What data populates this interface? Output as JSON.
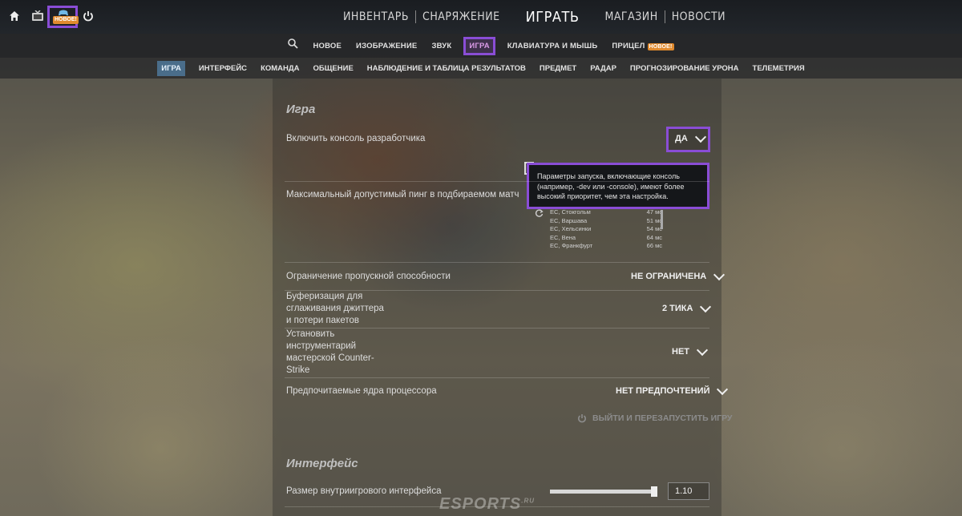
{
  "topbar": {
    "home_icon": "home-icon",
    "tv_icon": "tv-icon",
    "new_badge": "НОВОЕ!",
    "power_icon": "power-icon"
  },
  "main_nav": {
    "inventory": "ИНВЕНТАРЬ",
    "loadout": "СНАРЯЖЕНИЕ",
    "play": "ИГРАТЬ",
    "store": "МАГАЗИН",
    "news": "НОВОСТИ"
  },
  "settings_nav": {
    "items": [
      "НОВОЕ",
      "ИЗОБРАЖЕНИЕ",
      "ЗВУК",
      "ИГРА",
      "КЛАВИАТУРА И МЫШЬ",
      "ПРИЦЕЛ"
    ],
    "crosshair_badge": "НОВОЕ!"
  },
  "tabs": [
    "ИГРА",
    "ИНТЕРФЕЙС",
    "КОМАНДА",
    "ОБЩЕНИЕ",
    "НАБЛЮДЕНИЕ И ТАБЛИЦА РЕЗУЛЬТАТОВ",
    "ПРЕДМЕТ",
    "РАДАР",
    "ПРОГНОЗИРОВАНИЕ УРОНА",
    "ТЕЛЕМЕТРИЯ"
  ],
  "game_section": {
    "title": "Игра",
    "dev_console": {
      "label": "Включить консоль разработчика",
      "value": "ДА"
    },
    "tooltip": "Параметры запуска, включающие консоль (например, -dev или -console), имеют более высокий приоритет, чем эта настройка.",
    "max_ping": {
      "label": "Максимальный допустимый пинг в подбираемом матч"
    },
    "servers": [
      {
        "name": "ЕС, Стокгольм",
        "ping": "47 мс"
      },
      {
        "name": "ЕС, Варшава",
        "ping": "51 мс"
      },
      {
        "name": "ЕС, Хельсинки",
        "ping": "54 мс"
      },
      {
        "name": "ЕС, Вена",
        "ping": "64 мс"
      },
      {
        "name": "ЕС, Франкфурт",
        "ping": "66 мс"
      }
    ],
    "bandwidth": {
      "label": "Ограничение пропускной способности",
      "value": "НЕ ОГРАНИЧЕНА"
    },
    "buffering": {
      "label_lines": [
        "Буферизация для",
        "сглаживания джиттера",
        "и потери пакетов"
      ],
      "value": "2 ТИКА"
    },
    "workshop": {
      "label_lines": [
        "Установить",
        "инструментарий",
        "мастерской Counter-",
        "Strike"
      ],
      "value": "НЕТ"
    },
    "cores": {
      "label": "Предпочитаемые ядра процессора",
      "value": "НЕТ ПРЕДПОЧТЕНИЙ"
    },
    "restart_button": "ВЫЙТИ И ПЕРЕЗАПУСТИТЬ ИГРУ"
  },
  "interface_section": {
    "title": "Интерфейс",
    "hud_scale": {
      "label": "Размер внутриигрового интерфейса",
      "value": "1.10",
      "level": 0.95
    }
  },
  "watermark": {
    "text": "ESPORTS",
    "suffix": ".RU"
  },
  "colors": {
    "highlight": "#8a4dd6",
    "badge": "#e08a2e",
    "active_tab": "#4a6d8a"
  }
}
